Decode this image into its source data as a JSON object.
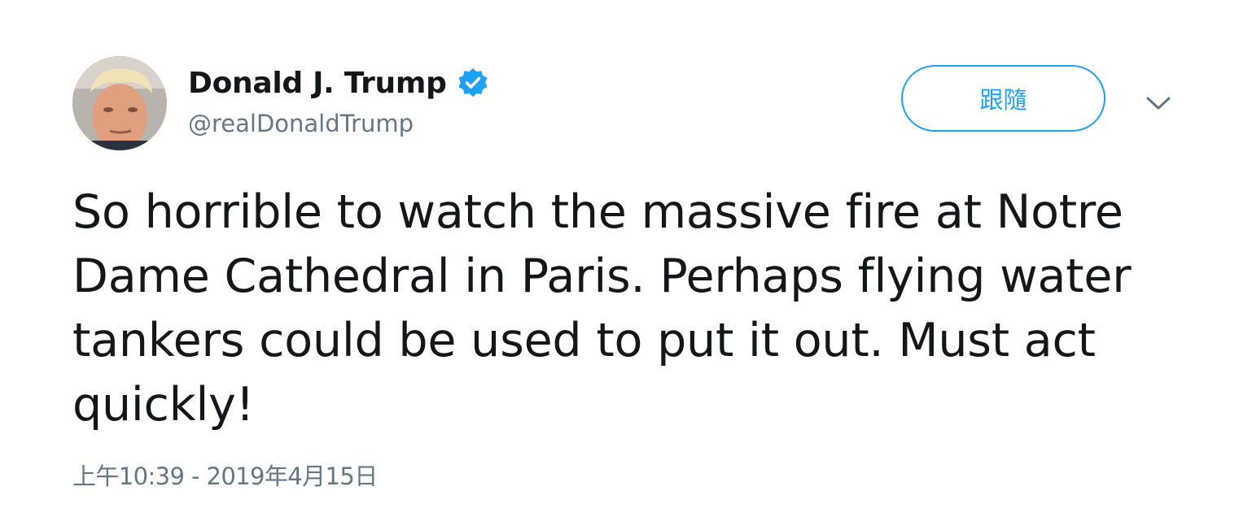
{
  "author": {
    "display_name": "Donald J. Trump",
    "handle": "@realDonaldTrump",
    "verified": true,
    "avatar_icon": "user-photo"
  },
  "actions": {
    "follow_label": "跟隨",
    "caret_icon": "chevron-down-icon"
  },
  "tweet": {
    "text": "So horrible to watch the massive fire at Notre\nDame Cathedral in Paris. Perhaps flying water\ntankers could be used to put it out. Must act\nquickly!",
    "timestamp": "上午10:39 - 2019年4月15日"
  },
  "colors": {
    "accent": "#1da1f2",
    "text": "#14171a",
    "secondary": "#657786"
  }
}
